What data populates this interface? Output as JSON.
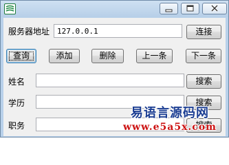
{
  "window": {
    "icon": "easy-language-app-icon",
    "controls": {
      "minimize_icon": "minimize-icon",
      "maximize_icon": "maximize-icon",
      "close_icon": "close-icon"
    }
  },
  "server": {
    "label": "服务器地址",
    "address_value": "127.0.0.1",
    "connect_label": "连接"
  },
  "toolbar": {
    "query_label": "查询",
    "add_label": "添加",
    "delete_label": "删除",
    "prev_label": "上一条",
    "next_label": "下一条"
  },
  "fields": [
    {
      "label": "姓名",
      "value": "",
      "search_label": "搜索"
    },
    {
      "label": "学历",
      "value": "",
      "search_label": "搜索"
    },
    {
      "label": "职务",
      "value": "",
      "search_label": "搜索"
    }
  ],
  "watermark": {
    "title": "易语言源码网",
    "url": "www.e5a5x.com"
  }
}
